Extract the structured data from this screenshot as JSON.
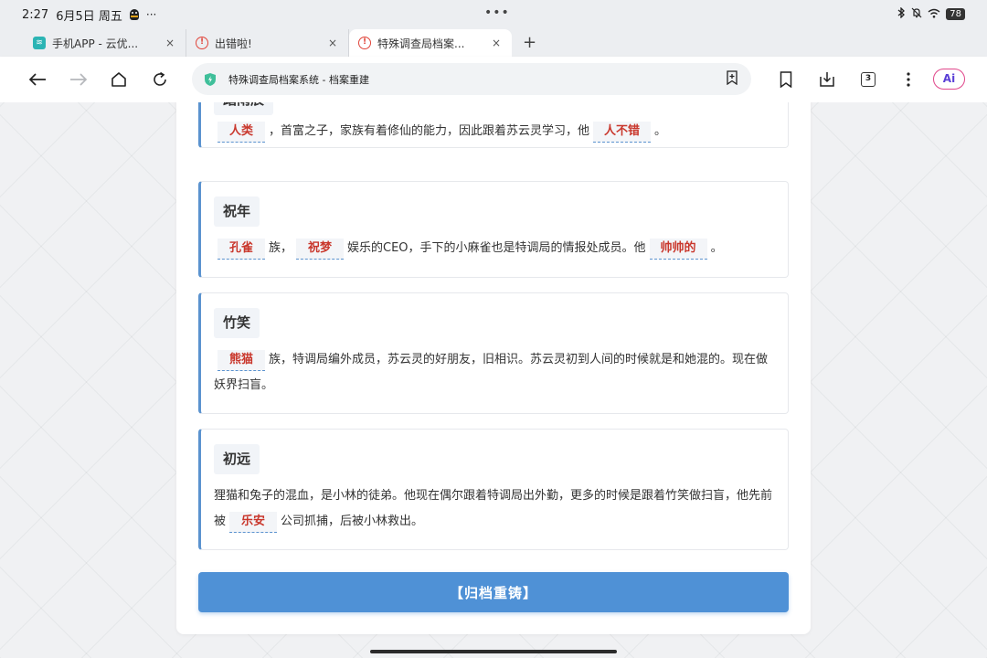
{
  "status": {
    "time": "2:27",
    "date": "6月5日 周五",
    "more": "···",
    "center_dots": "•••",
    "battery": "78"
  },
  "tabs": [
    {
      "title": "手机APP - 云优...",
      "favicon": "cloud-icon"
    },
    {
      "title": "出错啦!",
      "favicon": "error-icon"
    },
    {
      "title": "特殊调查局档案...",
      "favicon": "error-icon",
      "active": true
    }
  ],
  "tab_close": "×",
  "tab_add": "+",
  "toolbar": {
    "url": "特殊调查局档案系统 - 档案重建",
    "tab_count": "3",
    "ai_label": "Ai"
  },
  "cards": [
    {
      "name": "踏雨辰",
      "segments": [
        {
          "blank": "人类"
        },
        {
          "text": "，首富之子，家族有着修仙的能力，因此跟着苏云灵学习，他"
        },
        {
          "blank": "人不错"
        },
        {
          "text": "。"
        }
      ]
    },
    {
      "name": "祝年",
      "segments": [
        {
          "blank": "孔雀"
        },
        {
          "text": "族，"
        },
        {
          "blank": "祝梦"
        },
        {
          "text": "娱乐的CEO，手下的小麻雀也是特调局的情报处成员。他"
        },
        {
          "blank": "帅帅的"
        },
        {
          "text": "。"
        }
      ]
    },
    {
      "name": "竹笑",
      "segments": [
        {
          "blank": "熊猫"
        },
        {
          "text": "族，特调局编外成员，苏云灵的好朋友，旧相识。苏云灵初到人间的时候就是和她混的。现在做妖界扫盲。"
        }
      ]
    },
    {
      "name": "初远",
      "segments": [
        {
          "text": "狸猫和兔子的混血，是小林的徒弟。他现在偶尔跟着特调局出外勤，更多的时候是跟着竹笑做扫盲，他先前被"
        },
        {
          "blank": "乐安"
        },
        {
          "text": "公司抓捕，后被小林救出。"
        }
      ]
    }
  ],
  "submit_label": "【归档重铸】",
  "colors": {
    "accent": "#4f91d6",
    "card_border": "#5b93cf",
    "fill_text": "#c9372c"
  }
}
